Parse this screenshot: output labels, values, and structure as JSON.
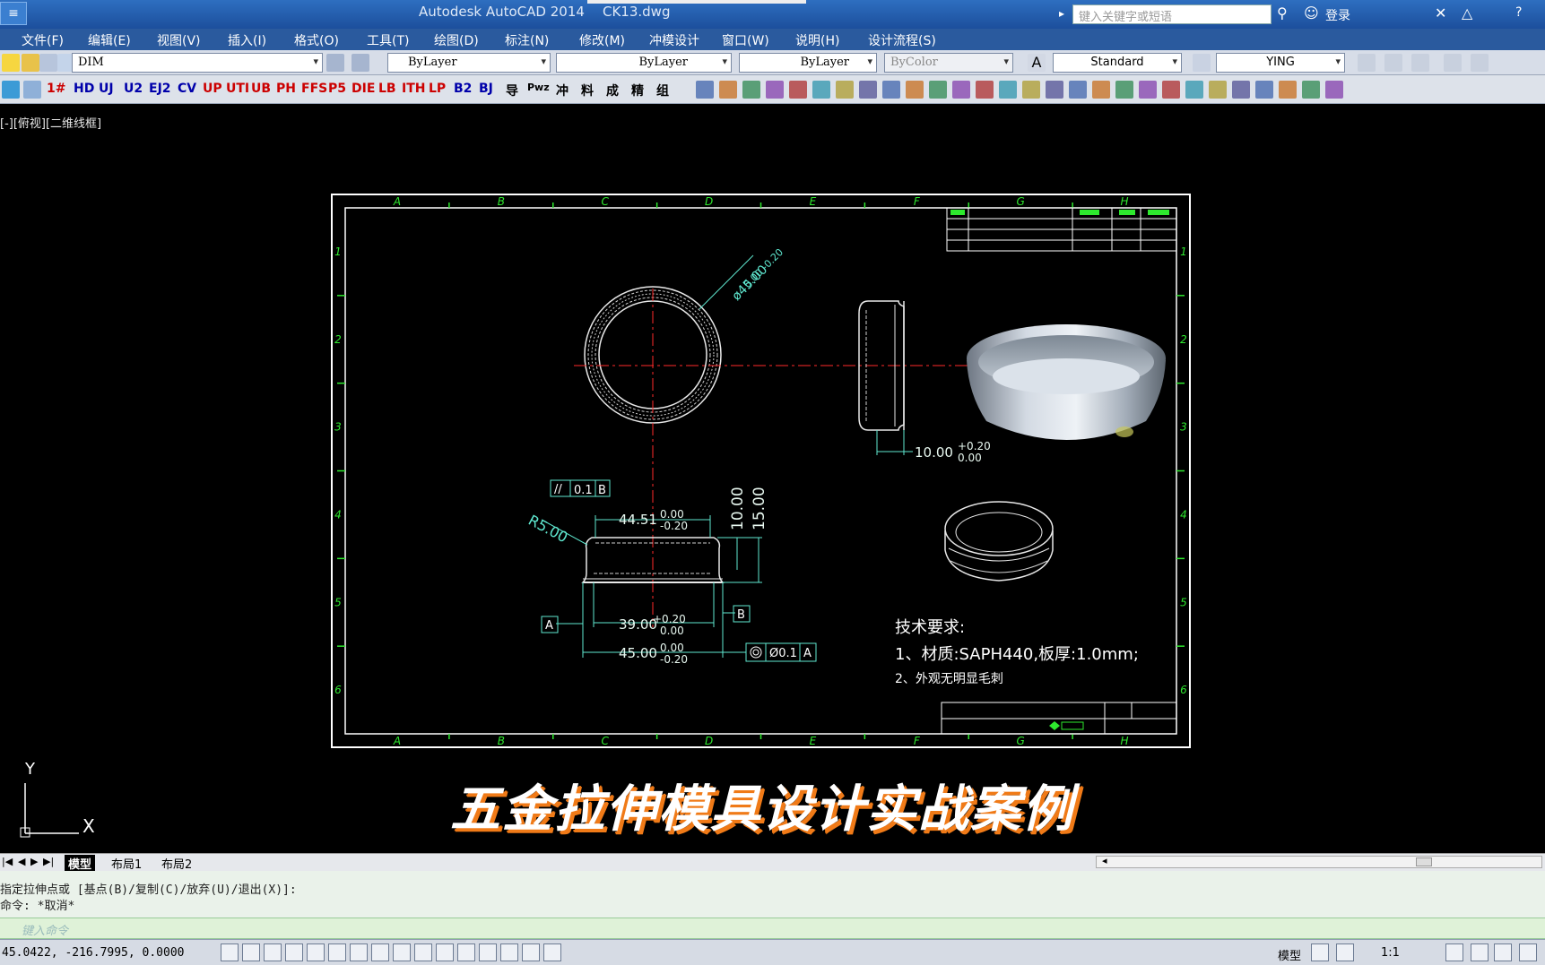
{
  "titlebar": {
    "app_title": "Autodesk AutoCAD 2014",
    "file_name": "CK13.dwg",
    "search_placeholder": "键入关键字或短语",
    "login": "登录",
    "help": "?"
  },
  "menu": [
    "文件(F)",
    "编辑(E)",
    "视图(V)",
    "插入(I)",
    "格式(O)",
    "工具(T)",
    "绘图(D)",
    "标注(N)",
    "修改(M)",
    "冲模设计",
    "窗口(W)",
    "说明(H)",
    "设计流程(S)"
  ],
  "toolbar1": {
    "layer": "DIM",
    "color": "ByLayer",
    "linetype": "ByLayer",
    "lineweight": "ByLayer",
    "plotstyle": "ByColor",
    "textstyle": "Standard",
    "dimstyle": "YING"
  },
  "toolbar2_labels": [
    "1#",
    "HD",
    "UJ",
    "U2",
    "EJ2",
    "CV",
    "UP",
    "UTI",
    "UB",
    "PH",
    "FFS",
    "P5",
    "DIE",
    "LB",
    "ITH",
    "LP",
    "B2",
    "BJ",
    "导",
    "Pwz",
    "冲",
    "料",
    "成",
    "精",
    "组"
  ],
  "viewport_label": "[-][俯视][二维线框]",
  "drawing": {
    "col_labels": [
      "A",
      "B",
      "C",
      "D",
      "E",
      "F",
      "G",
      "H"
    ],
    "row_labels": [
      "1",
      "2",
      "3",
      "4",
      "5",
      "6"
    ],
    "dims": {
      "dia45_top": "ø45.00",
      "dia45_tol": "0.00 -0.20",
      "dim_10": "10.00",
      "dim_10_tol_up": "+0.20",
      "dim_10_tol_dn": "0.00",
      "flat": "0.1",
      "flat_ref": "B",
      "width_4451": "44.51",
      "tol_000": "0.00",
      "tol_020": "-0.20",
      "tol_p020": "+0.20",
      "r5": "R5.00",
      "h10": "10.00",
      "h15": "15.00",
      "w39": "39.00",
      "w45": "45.00",
      "datum_a": "A",
      "datum_b": "B",
      "conc": "Ø0.1",
      "conc_ref": "A"
    },
    "tech_title": "技术要求:",
    "tech_1": "1、材质:SAPH440,板厚:1.0mm;",
    "tech_2": "2、外观无明显毛刺"
  },
  "subtitle": "五金拉伸模具设计实战案例",
  "ucs": {
    "y": "Y",
    "x": "X"
  },
  "tabs": [
    "模型",
    "布局1",
    "布局2"
  ],
  "command": {
    "line1": "指定拉伸点或 [基点(B)/复制(C)/放弃(U)/退出(X)]:",
    "line2": "命令: *取消*",
    "input_placeholder": "键入命令"
  },
  "status": {
    "coords": "45.0422, -216.7995, 0.0000",
    "model": "模型",
    "scale": "1:1"
  },
  "colors": {
    "border": "#ffffff",
    "label": "#2ee82e",
    "dim": "#5fe8d0",
    "center": "#ff2a2a",
    "accent_orange": "#f07a17"
  }
}
